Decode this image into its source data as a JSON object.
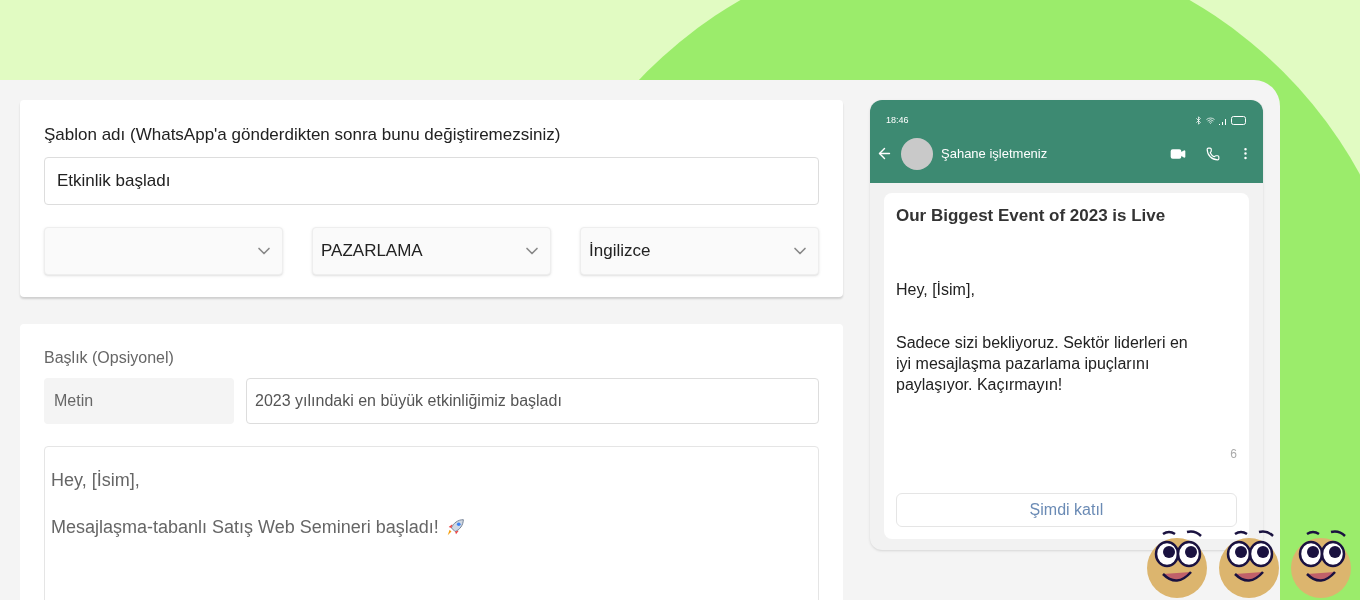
{
  "template_name": {
    "label": "Şablon adı (WhatsApp'a gönderdikten sonra bunu değiştiremezsiniz)",
    "value": "Etkinlik başladı"
  },
  "selects": [
    {
      "kind": "dropdown"
    },
    {
      "kind": "dropdown",
      "value": "PAZARLAMA"
    },
    {
      "kind": "dropdown",
      "value": "İngilizce"
    }
  ],
  "header": {
    "label": "Başlık (Opsiyonel)",
    "type": "Metin",
    "value": "2023 yılındaki en büyük etkinliğimiz başladı"
  },
  "body": {
    "lines": [
      "Hey, [İsim],",
      "Mesajlaşma-tabanlı Satış Web Semineri başladı!"
    ]
  },
  "preview": {
    "time": "18:46",
    "contact": "Şahane işletmeniz",
    "title": "Our Biggest Event of 2023 is Live",
    "paragraphs": [
      "Hey, [İsim],",
      "Sadece sizi bekliyoruz. Sektör liderleri en iyi mesajlaşma pazarlama ipuçlarını paylaşıyor. Kaçırmayın!"
    ],
    "count": "6",
    "button": "Şimdi katıl"
  }
}
